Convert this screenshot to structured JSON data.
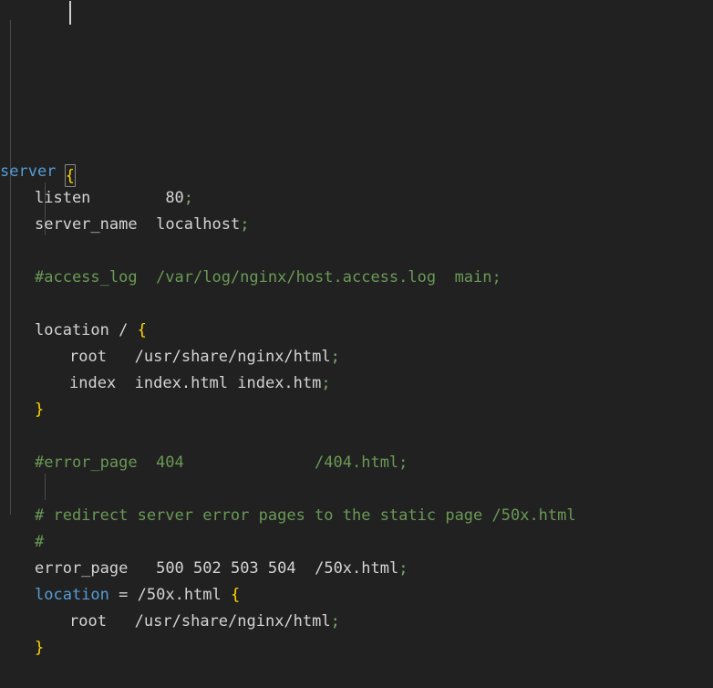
{
  "editor": {
    "language": "nginx",
    "theme": "dark-plus",
    "font_size_px": 17,
    "line_height_px": 29,
    "colors": {
      "background": "#212121",
      "foreground": "#d4d4d4",
      "comment": "#6a9955",
      "keyword": "#569cd6",
      "string": "#ce9178",
      "number": "#b5cea8",
      "punctuation": "#d4d4d4",
      "brace_level1": "#ffd700",
      "brace_level2": "#da70d6",
      "semicolon": "#7ba86a",
      "indent_guide": "#4a4a4a",
      "bracket_match_border": "#888a85"
    },
    "caret": {
      "line": 1,
      "column": 8,
      "visible": true
    },
    "bracket_match": {
      "line": 1,
      "char": "{"
    }
  },
  "lines": [
    {
      "n": 1,
      "indent": 0,
      "tokens": [
        {
          "t": "server",
          "c": "keyword"
        },
        {
          "t": " ",
          "c": "plain"
        },
        {
          "t": "{",
          "c": "brace1",
          "match": true
        }
      ]
    },
    {
      "n": 2,
      "indent": 1,
      "tokens": [
        {
          "t": "listen",
          "c": "plain"
        },
        {
          "t": "        ",
          "c": "plain"
        },
        {
          "t": "80",
          "c": "plain"
        },
        {
          "t": ";",
          "c": "semicolon"
        }
      ]
    },
    {
      "n": 3,
      "indent": 1,
      "tokens": [
        {
          "t": "server_name",
          "c": "plain"
        },
        {
          "t": "  ",
          "c": "plain"
        },
        {
          "t": "localhost",
          "c": "plain"
        },
        {
          "t": ";",
          "c": "semicolon"
        }
      ]
    },
    {
      "n": 4,
      "indent": 0,
      "tokens": []
    },
    {
      "n": 5,
      "indent": 1,
      "tokens": [
        {
          "t": "#access_log  /var/log/nginx/host.access.log  main;",
          "c": "comment"
        }
      ]
    },
    {
      "n": 6,
      "indent": 0,
      "tokens": []
    },
    {
      "n": 7,
      "indent": 1,
      "tokens": [
        {
          "t": "location",
          "c": "plain"
        },
        {
          "t": " ",
          "c": "plain"
        },
        {
          "t": "/",
          "c": "plain"
        },
        {
          "t": " ",
          "c": "plain"
        },
        {
          "t": "{",
          "c": "brace2"
        }
      ]
    },
    {
      "n": 8,
      "indent": 2,
      "tokens": [
        {
          "t": "root",
          "c": "plain"
        },
        {
          "t": "   ",
          "c": "plain"
        },
        {
          "t": "/usr/share/nginx/html",
          "c": "plain"
        },
        {
          "t": ";",
          "c": "semicolon"
        }
      ]
    },
    {
      "n": 9,
      "indent": 2,
      "tokens": [
        {
          "t": "index",
          "c": "plain"
        },
        {
          "t": "  ",
          "c": "plain"
        },
        {
          "t": "index.html index.htm",
          "c": "plain"
        },
        {
          "t": ";",
          "c": "semicolon"
        }
      ]
    },
    {
      "n": 10,
      "indent": 1,
      "tokens": [
        {
          "t": "}",
          "c": "brace2"
        }
      ]
    },
    {
      "n": 11,
      "indent": 0,
      "tokens": []
    },
    {
      "n": 12,
      "indent": 1,
      "tokens": [
        {
          "t": "#error_page  404              /404.html;",
          "c": "comment"
        }
      ]
    },
    {
      "n": 13,
      "indent": 0,
      "tokens": []
    },
    {
      "n": 14,
      "indent": 1,
      "tokens": [
        {
          "t": "# redirect server error pages to the static page /50x.html",
          "c": "comment"
        }
      ]
    },
    {
      "n": 15,
      "indent": 1,
      "tokens": [
        {
          "t": "#",
          "c": "comment"
        }
      ]
    },
    {
      "n": 16,
      "indent": 1,
      "tokens": [
        {
          "t": "error_page",
          "c": "plain"
        },
        {
          "t": "   ",
          "c": "plain"
        },
        {
          "t": "500 502 503 504",
          "c": "plain"
        },
        {
          "t": "  ",
          "c": "plain"
        },
        {
          "t": "/50x.html",
          "c": "plain"
        },
        {
          "t": ";",
          "c": "semicolon"
        }
      ]
    },
    {
      "n": 17,
      "indent": 1,
      "tokens": [
        {
          "t": "location",
          "c": "keyword"
        },
        {
          "t": " ",
          "c": "plain"
        },
        {
          "t": "=",
          "c": "plain"
        },
        {
          "t": " ",
          "c": "plain"
        },
        {
          "t": "/50x.html",
          "c": "plain"
        },
        {
          "t": " ",
          "c": "plain"
        },
        {
          "t": "{",
          "c": "brace2"
        }
      ]
    },
    {
      "n": 18,
      "indent": 2,
      "tokens": [
        {
          "t": "root",
          "c": "plain"
        },
        {
          "t": "   ",
          "c": "plain"
        },
        {
          "t": "/usr/share/nginx/html",
          "c": "plain"
        },
        {
          "t": ";",
          "c": "semicolon"
        }
      ]
    },
    {
      "n": 19,
      "indent": 1,
      "tokens": [
        {
          "t": "}",
          "c": "brace2"
        }
      ]
    }
  ]
}
